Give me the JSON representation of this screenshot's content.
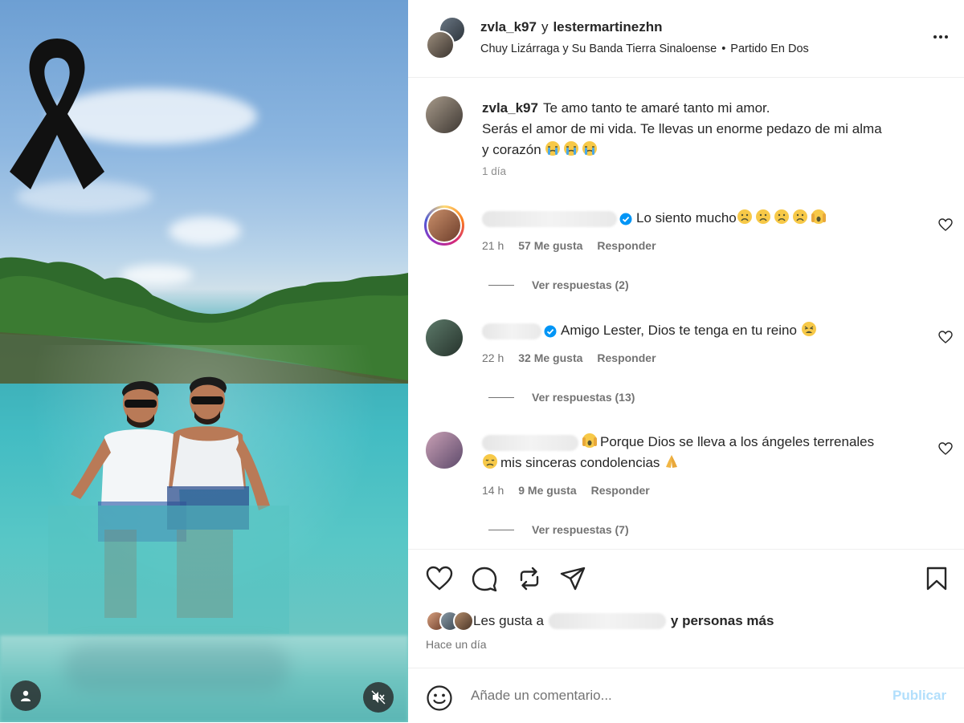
{
  "header": {
    "user1": "zvla_k97",
    "conj": "y",
    "user2": "lestermartinezhn",
    "audio_artist": "Chuy Lizárraga y Su Banda Tierra Sinaloense",
    "audio_sep": "•",
    "audio_track": "Partido En Dos"
  },
  "caption": {
    "author": "zvla_k97",
    "line1": "Te amo tanto te amaré tanto mi amor.",
    "line2": "Serás el amor de mi vida. Te llevas un enorme pedazo de mi alma",
    "line3": "y corazón",
    "time": "1 día"
  },
  "comments": [
    {
      "text": "Lo siento mucho",
      "time": "21 h",
      "likes": "57 Me gusta",
      "reply": "Responder",
      "replies": "Ver respuestas (2)"
    },
    {
      "text": "Amigo Lester, Dios te tenga en tu reino",
      "time": "22 h",
      "likes": "32 Me gusta",
      "reply": "Responder",
      "replies": "Ver respuestas (13)"
    },
    {
      "text1": "Porque Dios se lleva a los ángeles terrenales",
      "text2": "mis sinceras condolencias",
      "time": "14 h",
      "likes": "9 Me gusta",
      "reply": "Responder",
      "replies": "Ver respuestas (7)"
    }
  ],
  "likes": {
    "prefix": "Les gusta a",
    "suffix": "y personas más",
    "ago": "Hace un día"
  },
  "composer": {
    "placeholder": "Añade un comentario...",
    "post": "Publicar"
  },
  "colors": {
    "verified": "#0095f6",
    "publish_disabled": "#b2dffc",
    "ribbon": "#111111"
  },
  "icons": [
    "mourning-ribbon-icon",
    "user-tag-icon",
    "mute-icon",
    "more-icon",
    "verified-icon",
    "heart-icon",
    "comment-icon",
    "repost-icon",
    "share-icon",
    "bookmark-icon",
    "emoji-icon"
  ]
}
